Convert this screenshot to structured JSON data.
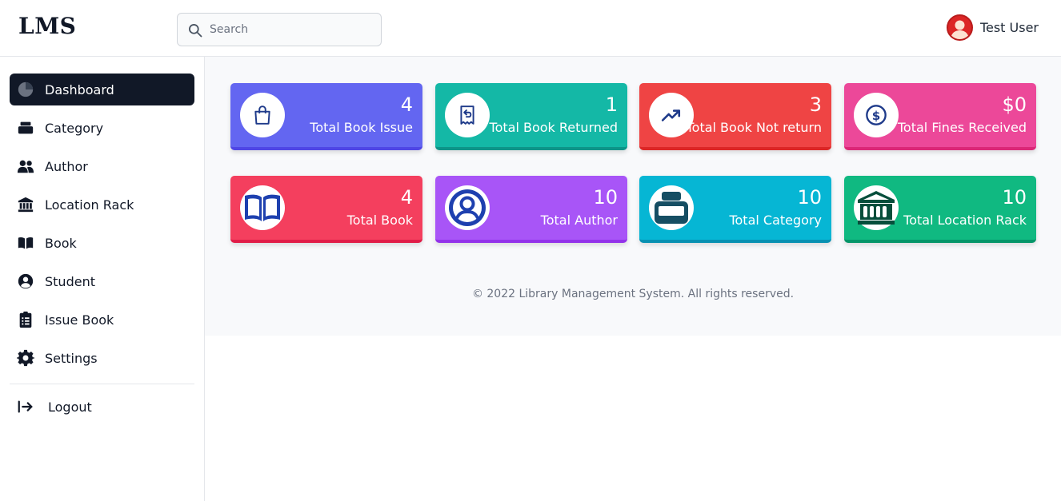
{
  "header": {
    "logo": "LMS",
    "search_placeholder": "Search",
    "user_name": "Test User"
  },
  "sidebar": {
    "items": [
      {
        "label": "Dashboard",
        "icon": "pie-chart-icon",
        "active": true
      },
      {
        "label": "Category",
        "icon": "layers-icon"
      },
      {
        "label": "Author",
        "icon": "users-icon"
      },
      {
        "label": "Location Rack",
        "icon": "building-columns-icon"
      },
      {
        "label": "Book",
        "icon": "open-book-icon"
      },
      {
        "label": "Student",
        "icon": "user-circle-icon"
      },
      {
        "label": "Issue Book",
        "icon": "clipboard-list-icon"
      },
      {
        "label": "Settings",
        "icon": "gear-icon"
      }
    ],
    "logout_label": "Logout"
  },
  "cards": [
    {
      "value": "4",
      "label": "Total Book Issue",
      "color": "#6366f1",
      "icon": "shopping-bag-icon"
    },
    {
      "value": "1",
      "label": "Total Book Returned",
      "color": "#14b8a6",
      "icon": "receipt-refund-icon"
    },
    {
      "value": "3",
      "label": "Total Book Not return",
      "color": "#ef4444",
      "icon": "trending-up-icon"
    },
    {
      "value": "$0",
      "label": "Total Fines Received",
      "color": "#ec4899",
      "icon": "dollar-circle-icon"
    },
    {
      "value": "4",
      "label": "Total Book",
      "color": "#f43f5e",
      "icon": "open-book-icon"
    },
    {
      "value": "10",
      "label": "Total Author",
      "color": "#a855f7",
      "icon": "user-circle-icon"
    },
    {
      "value": "10",
      "label": "Total Category",
      "color": "#06b6d4",
      "icon": "layers-icon"
    },
    {
      "value": "10",
      "label": "Total Location Rack",
      "color": "#10b981",
      "icon": "building-columns-icon"
    }
  ],
  "footer": "© 2022 Library Management System. All rights reserved."
}
